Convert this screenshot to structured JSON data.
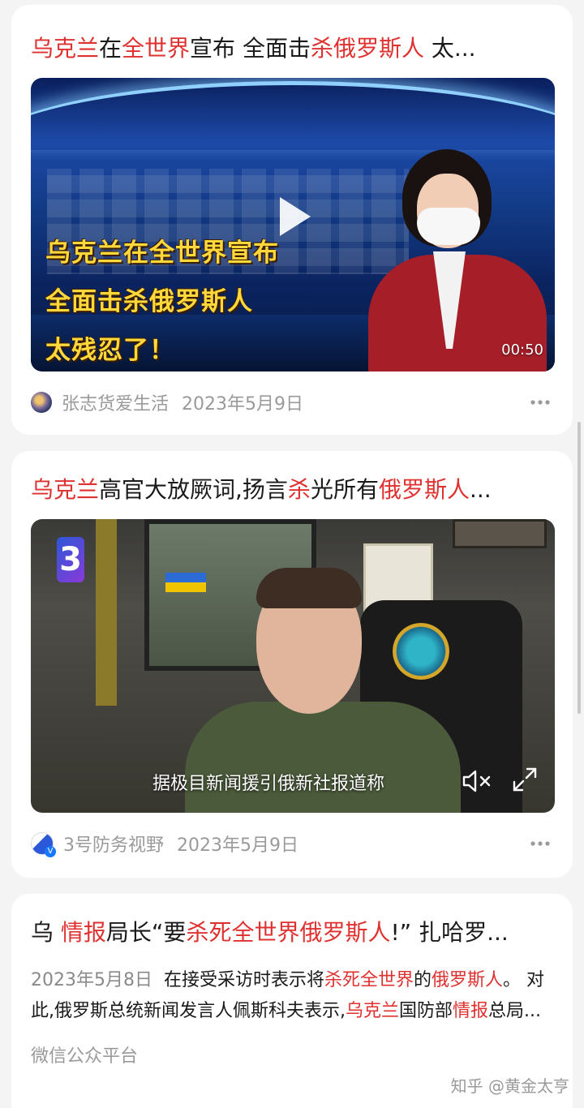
{
  "cards": [
    {
      "title_segments": [
        {
          "text": "乌克兰",
          "hl": true
        },
        {
          "text": "在",
          "hl": false
        },
        {
          "text": "全世界",
          "hl": true
        },
        {
          "text": "宣布 全面击",
          "hl": false
        },
        {
          "text": "杀俄罗斯人",
          "hl": true
        },
        {
          "text": " 太...",
          "hl": false
        }
      ],
      "video": {
        "overlay_lines": [
          "乌克兰在全世界宣布",
          "全面击杀俄罗斯人",
          "太残忍了！"
        ],
        "duration": "00:50"
      },
      "author": "张志货爱生活",
      "date": "2023年5月9日"
    },
    {
      "title_segments": [
        {
          "text": "乌克兰",
          "hl": true
        },
        {
          "text": "高官大放厥词,扬言",
          "hl": false
        },
        {
          "text": "杀",
          "hl": true
        },
        {
          "text": "光所有",
          "hl": false
        },
        {
          "text": "俄罗斯人",
          "hl": true
        },
        {
          "text": "...",
          "hl": false
        }
      ],
      "video": {
        "channel_logo": "3",
        "subtitle": "据极目新闻援引俄新社报道称"
      },
      "author": "3号防务视野",
      "date": "2023年5月9日"
    },
    {
      "title_segments": [
        {
          "text": "乌 ",
          "hl": false
        },
        {
          "text": "情报",
          "hl": true
        },
        {
          "text": "局长“要",
          "hl": false
        },
        {
          "text": "杀死全世界俄罗斯人",
          "hl": true
        },
        {
          "text": "!” 扎哈罗...",
          "hl": false
        }
      ],
      "summary_date": "2023年5月8日",
      "summary_segments": [
        {
          "text": "在接受采访时表示将",
          "hl": false
        },
        {
          "text": "杀死全世界",
          "hl": true
        },
        {
          "text": "的",
          "hl": false
        },
        {
          "text": "俄罗斯人",
          "hl": true
        },
        {
          "text": "。 对此,俄罗斯总统新闻发言人佩斯科夫表示,",
          "hl": false
        },
        {
          "text": "乌克兰",
          "hl": true
        },
        {
          "text": "国防部",
          "hl": false
        },
        {
          "text": "情报",
          "hl": true
        },
        {
          "text": "总局...",
          "hl": false
        }
      ],
      "source": "微信公众平台"
    }
  ],
  "watermark": "知乎 @黄金太亨",
  "icons": {
    "play": "play-icon",
    "more": "more-dots-icon",
    "mute": "mute-icon",
    "fullscreen": "fullscreen-icon"
  },
  "colors": {
    "highlight": "#e03131",
    "meta": "#9a9a9a"
  }
}
